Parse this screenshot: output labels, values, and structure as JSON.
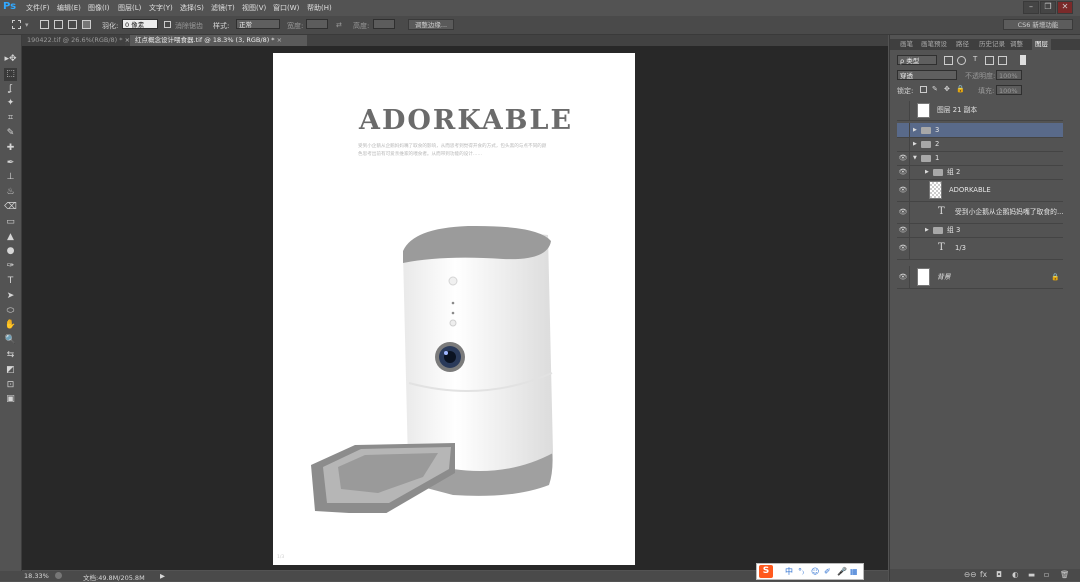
{
  "app": {
    "logo": "Ps"
  },
  "menu": [
    "文件(F)",
    "编辑(E)",
    "图像(I)",
    "图层(L)",
    "文字(Y)",
    "选择(S)",
    "滤镜(T)",
    "视图(V)",
    "窗口(W)",
    "帮助(H)"
  ],
  "window_buttons": [
    "–",
    "❐",
    "✕"
  ],
  "options": {
    "feather_label": "羽化:",
    "feather_value": "0 像素",
    "antialias_label": "消除锯齿",
    "style_label": "样式:",
    "style_value": "正常",
    "width_label": "宽度:",
    "height_label": "高度:",
    "refine_edge": "调整边缘...",
    "workspace": "CS6 新增功能"
  },
  "tabs": [
    {
      "label": "190422.tif @ 26.6%(RGB/8) *",
      "close": "×"
    },
    {
      "label": "红点概念设计喂食器.tif @ 18.3% (3, RGB/8) *",
      "close": "×"
    }
  ],
  "tools": [
    "▸✥",
    "⬚",
    "ʆ",
    "✦",
    "⌗",
    "✎",
    "✚",
    "✒",
    "⊥",
    "♨",
    "⌫",
    "▭",
    "▲",
    "●",
    "✑",
    "T",
    "➤",
    "⬭",
    "✋",
    "🔍",
    "⇆",
    "◩",
    "⊡",
    "▣"
  ],
  "document": {
    "title": "ADORKABLE",
    "body": "受到小企鹅从企鹅妈妈嘴了取食的影响，从而思考到觉得开食的方式，包头黑的与点不同的颜色思考出前有可爱亲维家的喂食者。从而带到功能的设计……",
    "page_number": "1/3"
  },
  "status": {
    "zoom": "18.33%",
    "doc_size": "文档:49.8M/205.8M",
    "arrow": "▶"
  },
  "ime": {
    "logo": "S",
    "items": [
      "中",
      "°₎",
      "☺",
      "✐",
      "🎤",
      "▦"
    ]
  },
  "panel": {
    "tabs": [
      "画笔",
      "画笔预设",
      "路径",
      "历史记录",
      "调整",
      "图层"
    ],
    "filter_kind": "ρ 类型",
    "blend_mode": "穿透",
    "opacity_label": "不透明度:",
    "opacity_value": "100%",
    "lock_label": "锁定:",
    "fill_label": "填充:",
    "fill_value": "100%",
    "layers": [
      {
        "name": "图层 21 副本",
        "type": "pixel",
        "visible": false,
        "selected": false,
        "indent": 0
      },
      {
        "name": "3",
        "type": "group",
        "visible": false,
        "selected": true,
        "indent": 0,
        "open": false
      },
      {
        "name": "2",
        "type": "group",
        "visible": false,
        "selected": false,
        "indent": 0,
        "open": false
      },
      {
        "name": "1",
        "type": "group",
        "visible": true,
        "selected": false,
        "indent": 0,
        "open": true
      },
      {
        "name": "组 2",
        "type": "group",
        "visible": true,
        "selected": false,
        "indent": 1,
        "open": false
      },
      {
        "name": "ADORKABLE",
        "type": "checker",
        "visible": true,
        "selected": false,
        "indent": 1
      },
      {
        "name": "受到小企鹅从企鹅妈妈嘴了取食的...",
        "type": "text",
        "visible": true,
        "selected": false,
        "indent": 1
      },
      {
        "name": "组 3",
        "type": "group",
        "visible": true,
        "selected": false,
        "indent": 1,
        "open": false
      },
      {
        "name": "1/3",
        "type": "text",
        "visible": true,
        "selected": false,
        "indent": 1
      },
      {
        "name": "背景",
        "type": "background",
        "visible": true,
        "selected": false,
        "indent": 0
      }
    ],
    "footer": [
      "⊖⊖",
      "fx",
      "◘",
      "◐",
      "▬",
      "▫",
      "🗑"
    ]
  }
}
